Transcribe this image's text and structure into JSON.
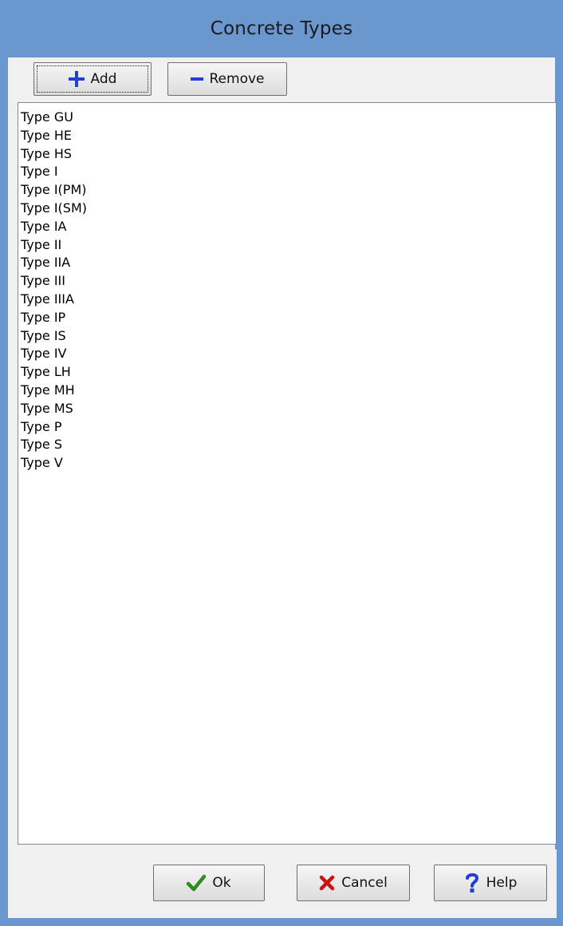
{
  "window": {
    "title": "Concrete Types"
  },
  "toolbar": {
    "add_label": "Add",
    "remove_label": "Remove"
  },
  "list": {
    "items": [
      "Type GU",
      "Type HE",
      "Type HS",
      "Type I",
      "Type I(PM)",
      "Type I(SM)",
      "Type IA",
      "Type II",
      "Type IIA",
      "Type III",
      "Type IIIA",
      "Type IP",
      "Type IS",
      "Type IV",
      "Type LH",
      "Type MH",
      "Type MS",
      "Type P",
      "Type S",
      "Type V"
    ]
  },
  "footer": {
    "ok_label": "Ok",
    "cancel_label": "Cancel",
    "help_label": "Help"
  },
  "icons": {
    "add": "plus-icon",
    "remove": "minus-icon",
    "ok": "checkmark-icon",
    "cancel": "x-icon",
    "help": "question-mark-icon"
  },
  "colors": {
    "titlebar": "#6b97cf",
    "accent_blue": "#1f3fd6",
    "ok_green": "#2e8b1e",
    "cancel_red": "#c81414"
  }
}
